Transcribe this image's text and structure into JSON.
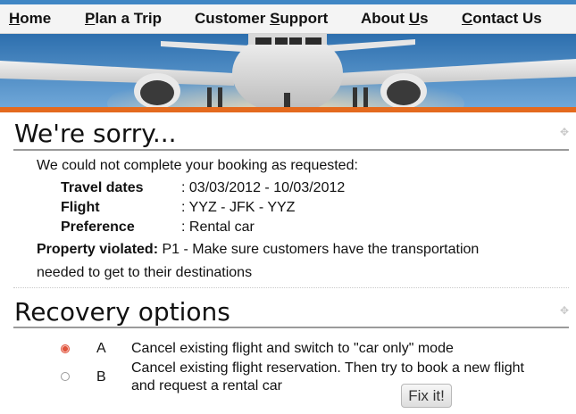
{
  "nav": {
    "items": [
      {
        "pre": "",
        "u": "H",
        "post": "ome"
      },
      {
        "pre": "",
        "u": "P",
        "post": "lan a Trip"
      },
      {
        "pre": "Customer ",
        "u": "S",
        "post": "upport"
      },
      {
        "pre": "About ",
        "u": "U",
        "post": "s"
      },
      {
        "pre": "",
        "u": "C",
        "post": "ontact Us"
      }
    ]
  },
  "sorry": {
    "title": "We're sorry...",
    "intro": "We could not complete your booking as requested:",
    "details": [
      {
        "label": "Travel dates",
        "value": ": 03/03/2012 - 10/03/2012"
      },
      {
        "label": "Flight",
        "value": ": YYZ - JFK - YYZ"
      },
      {
        "label": "Preference",
        "value": ": Rental car"
      }
    ],
    "property_label": "Property violated:",
    "property_text_line1": "P1 - Make sure customers have the transportation",
    "property_text_line2": "needed to get to their destinations"
  },
  "recovery": {
    "title": "Recovery options",
    "options": [
      {
        "key": "A",
        "line1": "Cancel existing flight and switch to \"car only\" mode",
        "line2": "",
        "selected": true
      },
      {
        "key": "B",
        "line1": "Cancel existing flight reservation. Then try to book a new flight",
        "line2": "and request a rental car",
        "selected": false
      }
    ],
    "fix_label": "Fix it!"
  },
  "colors": {
    "accent_blue": "#3f86c4",
    "accent_orange": "#e46a1e",
    "radio_selected": "#e0533c"
  }
}
